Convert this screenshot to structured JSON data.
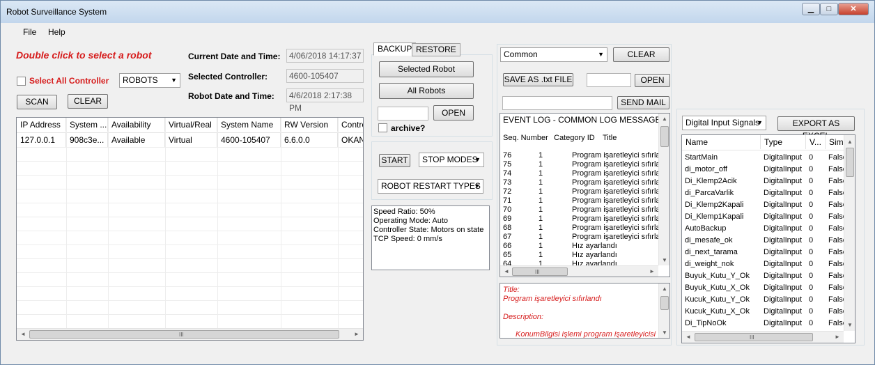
{
  "window": {
    "title": "Robot Surveillance System",
    "min": "▁",
    "max": "□",
    "close": "✕"
  },
  "menu": {
    "file": "File",
    "help": "Help"
  },
  "left": {
    "instruction": "Double click to select a robot",
    "select_all_label": "Select All Controller",
    "robots_combo": "ROBOTS",
    "scan": "SCAN",
    "clear": "CLEAR",
    "current_dt_label": "Current Date and Time:",
    "current_dt_value": "4/06/2018 14:17:37",
    "selected_ctrl_label": "Selected Controller:",
    "selected_ctrl_value": "4600-105407",
    "robot_dt_label": "Robot Date and Time:",
    "robot_dt_value": "4/6/2018 2:17:38 PM",
    "table": {
      "columns": [
        "IP Address",
        "System ...",
        "Availability",
        "Virtual/Real",
        "System Name",
        "RW Version",
        "Contro"
      ],
      "rows": [
        [
          "127.0.0.1",
          "908c3e...",
          "Available",
          "Virtual",
          "4600-105407",
          "6.6.0.0",
          "OKAN"
        ]
      ]
    }
  },
  "middle": {
    "tab_backup": "BACKUP",
    "tab_restore": "RESTORE",
    "selected_robot": "Selected Robot",
    "all_robots": "All Robots",
    "open": "OPEN",
    "archive": "archive?",
    "start": "START",
    "stop_modes": "STOP MODES",
    "restart_types": "ROBOT RESTART TYPES",
    "status_lines": [
      "Speed Ratio: 50%",
      "Operating Mode: Auto",
      "Controller State: Motors on state",
      "TCP Speed: 0 mm/s"
    ]
  },
  "log": {
    "combo": "Common",
    "clear": "CLEAR",
    "save_txt": "SAVE AS .txt FILE",
    "open": "OPEN",
    "send_mail": "SEND MAIL",
    "header": "EVENT LOG - COMMON LOG MESSAGES",
    "col_seq": "Seq. Number",
    "col_cat": "Category ID",
    "col_title": "Title",
    "rows": [
      [
        "76",
        "1",
        "Program işaretleyici sıfırlanı"
      ],
      [
        "75",
        "1",
        "Program işaretleyici sıfırlanı"
      ],
      [
        "74",
        "1",
        "Program işaretleyici sıfırlanı"
      ],
      [
        "73",
        "1",
        "Program işaretleyici sıfırlanı"
      ],
      [
        "72",
        "1",
        "Program işaretleyici sıfırlanı"
      ],
      [
        "71",
        "1",
        "Program işaretleyici sıfırlanı"
      ],
      [
        "70",
        "1",
        "Program işaretleyici sıfırlanı"
      ],
      [
        "69",
        "1",
        "Program işaretleyici sıfırlanı"
      ],
      [
        "68",
        "1",
        "Program işaretleyici sıfırlanı"
      ],
      [
        "67",
        "1",
        "Program işaretleyici sıfırlanı"
      ],
      [
        "66",
        "1",
        "Hız ayarlandı"
      ],
      [
        "65",
        "1",
        "Hız ayarlandı"
      ],
      [
        "64",
        "1",
        "Hız ayarlandı"
      ]
    ],
    "detail_title_label": "Title:",
    "detail_title_value": "Program işaretleyici sıfırlandı",
    "detail_desc_label": "Description:",
    "detail_desc_value": "KonumBilgisi işlemi program işaretleyicisi"
  },
  "signals": {
    "combo": "Digital Input Signals",
    "export": "EXPORT AS EXCEL",
    "columns": [
      "Name",
      "Type",
      "V...",
      "Simu"
    ],
    "rows": [
      [
        "StartMain",
        "DigitalInput",
        "0",
        "False"
      ],
      [
        "di_motor_off",
        "DigitalInput",
        "0",
        "False"
      ],
      [
        "Di_Klemp2Acik",
        "DigitalInput",
        "0",
        "False"
      ],
      [
        "di_ParcaVarlik",
        "DigitalInput",
        "0",
        "False"
      ],
      [
        "Di_Klemp2Kapali",
        "DigitalInput",
        "0",
        "False"
      ],
      [
        "Di_Klemp1Kapali",
        "DigitalInput",
        "0",
        "False"
      ],
      [
        "AutoBackup",
        "DigitalInput",
        "0",
        "False"
      ],
      [
        "di_mesafe_ok",
        "DigitalInput",
        "0",
        "False"
      ],
      [
        "di_next_tarama",
        "DigitalInput",
        "0",
        "False"
      ],
      [
        "di_weight_nok",
        "DigitalInput",
        "0",
        "False"
      ],
      [
        "Buyuk_Kutu_Y_Ok",
        "DigitalInput",
        "0",
        "False"
      ],
      [
        "Buyuk_Kutu_X_Ok",
        "DigitalInput",
        "0",
        "False"
      ],
      [
        "Kucuk_Kutu_Y_Ok",
        "DigitalInput",
        "0",
        "False"
      ],
      [
        "Kucuk_Kutu_X_Ok",
        "DigitalInput",
        "0",
        "False"
      ],
      [
        "Di_TipNoOk",
        "DigitalInput",
        "0",
        "False"
      ]
    ]
  },
  "scroll": {
    "up": "▲",
    "down": "▼",
    "left": "◄",
    "right": "►",
    "grip": "III"
  },
  "colors": {
    "accent_red": "#d61c1c",
    "window_bg": "#f0f0f0"
  }
}
